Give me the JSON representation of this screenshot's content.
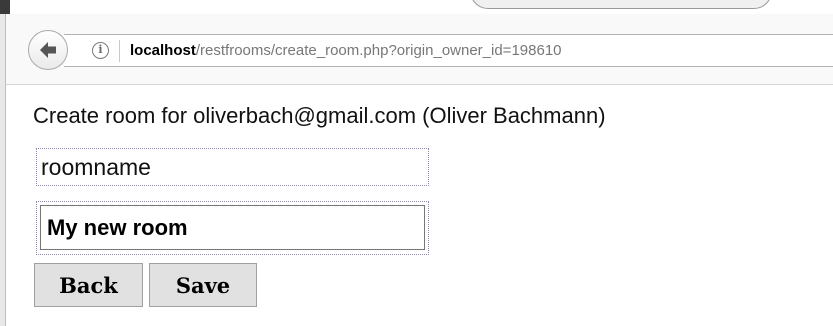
{
  "browser": {
    "url": {
      "host": "localhost",
      "path": "/restfrooms/create_room.php?origin_owner_id=198610"
    },
    "icons": {
      "back": "arrow-left-icon",
      "info": "info-icon"
    },
    "info_glyph": "i"
  },
  "page": {
    "heading": "Create room for oliverbach@gmail.com (Oliver Bachmann)",
    "field_label": "roomname",
    "room_name_value": "My new room",
    "buttons": {
      "back": "Back",
      "save": "Save"
    }
  }
}
